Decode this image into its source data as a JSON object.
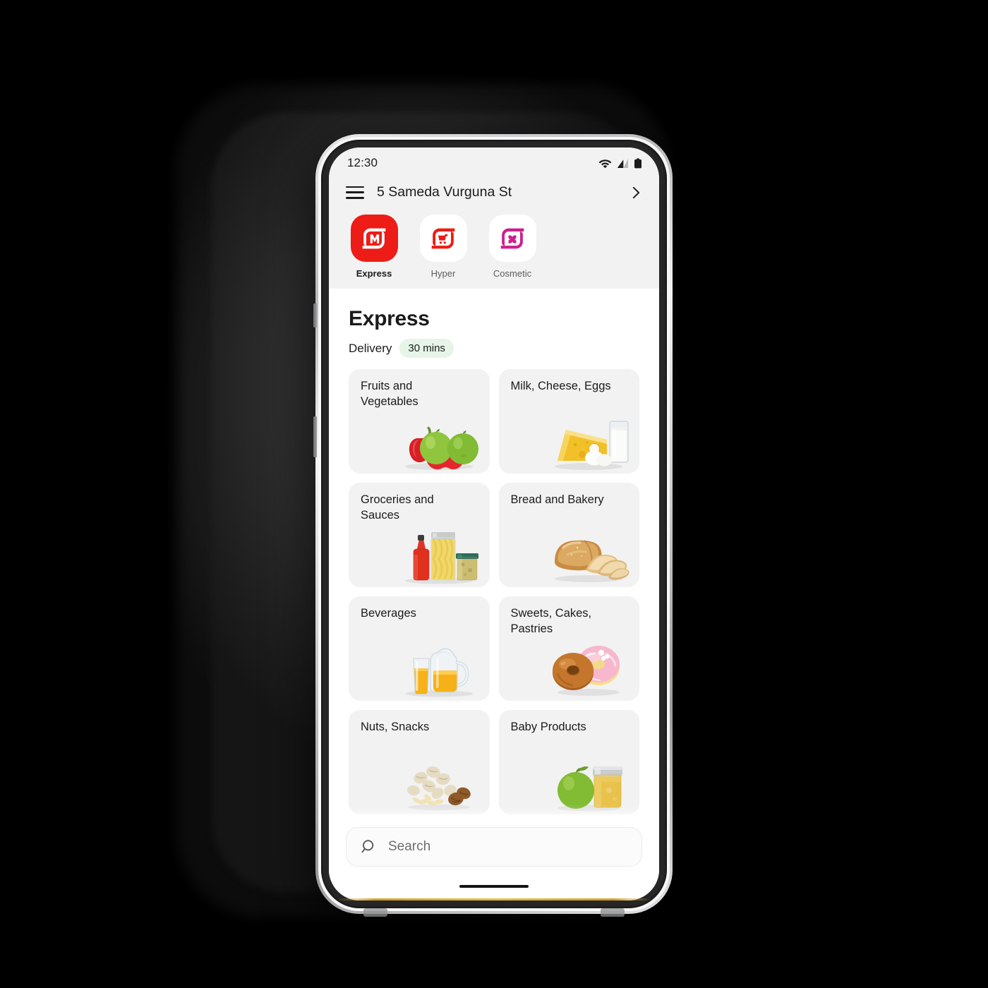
{
  "status_bar": {
    "time": "12:30",
    "icons": [
      "wifi-icon",
      "cellular-signal-icon",
      "battery-icon"
    ]
  },
  "header": {
    "menu_icon": "hamburger-menu-icon",
    "address": "5 Sameda Vurguna St",
    "chevron_icon": "chevron-right-icon"
  },
  "services": [
    {
      "id": "express",
      "label": "Express",
      "icon": "magnum-express-logo-icon",
      "tile_color": "#ed1c16",
      "mark_color": "#ffffff",
      "active": true
    },
    {
      "id": "hyper",
      "label": "Hyper",
      "icon": "magnum-hyper-cart-logo-icon",
      "tile_color": "#ffffff",
      "mark_color": "#ed1c16",
      "active": false
    },
    {
      "id": "cosmetic",
      "label": "Cosmetic",
      "icon": "magnum-cosmetic-logo-icon",
      "tile_color": "#ffffff",
      "mark_color": "#cc1f8d",
      "active": false
    }
  ],
  "sheet": {
    "title": "Express",
    "delivery_label": "Delivery",
    "delivery_time": "30 mins",
    "badge_color": "#e7f4e8"
  },
  "categories": [
    {
      "title": "Fruits and Vegetables",
      "art": "peppers-and-apples"
    },
    {
      "title": "Milk, Cheese, Eggs",
      "art": "cheese-eggs-milk"
    },
    {
      "title": "Groceries and Sauces",
      "art": "ketchup-pasta-jar"
    },
    {
      "title": "Bread and Bakery",
      "art": "bread-loaf-slices"
    },
    {
      "title": "Beverages",
      "art": "juice-glass-pitcher"
    },
    {
      "title": "Sweets, Cakes, Pastries",
      "art": "donuts"
    },
    {
      "title": "Nuts, Snacks",
      "art": "nuts-pistachios"
    },
    {
      "title": "Baby Products",
      "art": "apple-baby-food-jar"
    }
  ],
  "search": {
    "placeholder": "Search",
    "icon": "search-icon"
  }
}
